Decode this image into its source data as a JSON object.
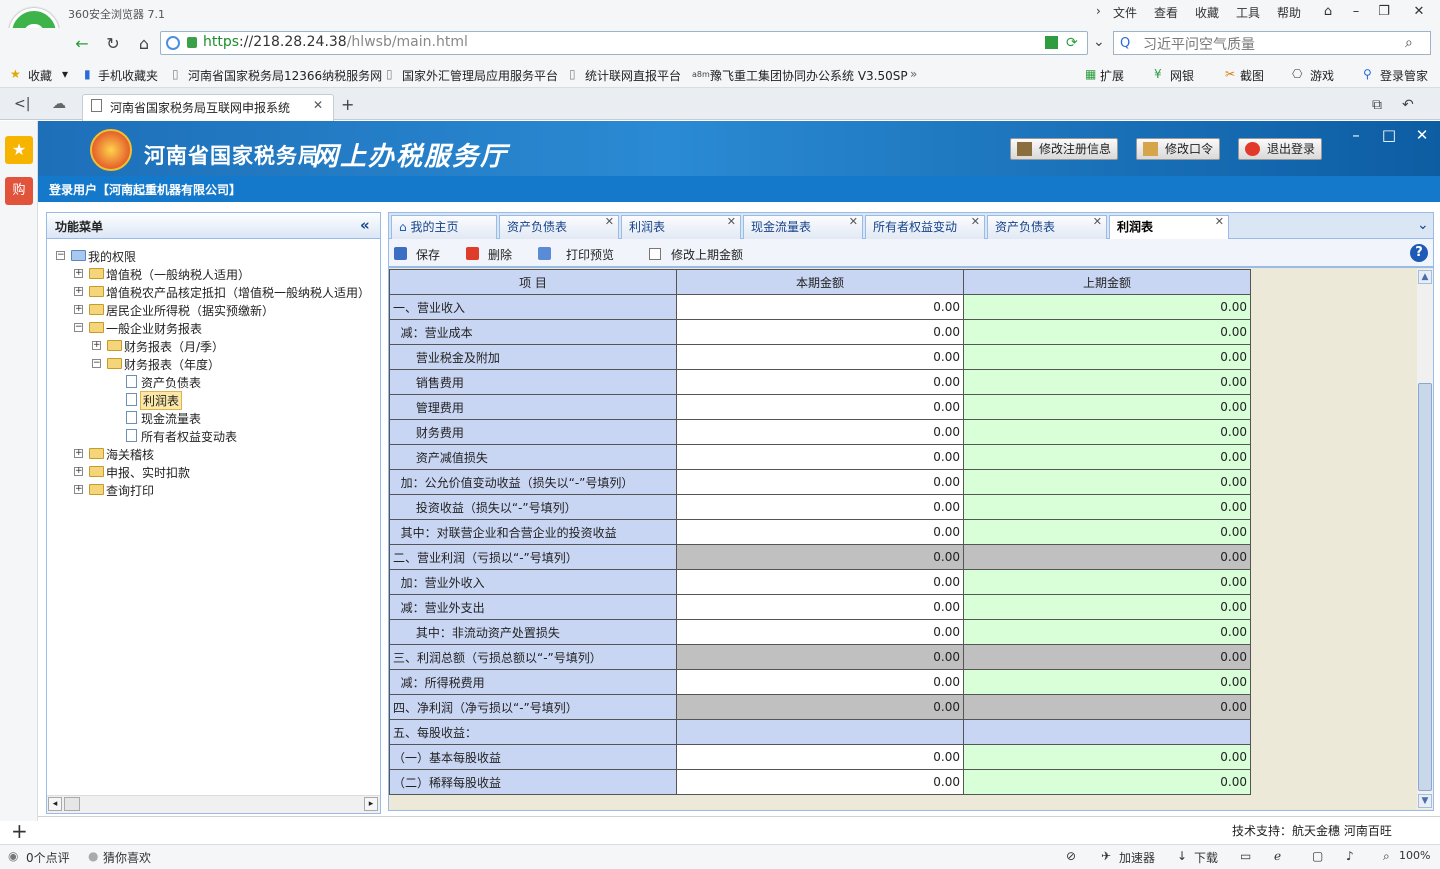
{
  "browser": {
    "name": "360安全浏览器 7.1",
    "menu": [
      "文件",
      "查看",
      "收藏",
      "工具",
      "帮助"
    ],
    "url_scheme": "https",
    "url_host": "://218.28.24.38",
    "url_path": "/hlwsb/main.html",
    "search_placeholder": "习近平问空气质量",
    "favorites": [
      "收藏",
      "手机收藏夹",
      "河南省国家税务局12366纳税服务网",
      "国家外汇管理局应用服务平台",
      "统计联网直报平台",
      "豫飞重工集团协同办公系统 V3.50SP"
    ],
    "tools": [
      "扩展",
      "网银",
      "截图",
      "游戏",
      "登录管家"
    ],
    "tab_title": "河南省国家税务局互联网申报系统",
    "status_left": [
      "0个点评",
      "猜你喜欢"
    ],
    "status_right": [
      "加速器",
      "下载",
      "100%"
    ]
  },
  "site": {
    "title1": "河南省国家税务局",
    "title2": "网上办税服务厅",
    "btn_reg": "修改注册信息",
    "btn_pwd": "修改口令",
    "btn_logout": "退出登录",
    "user": "登录用户【河南起重机器有限公司】",
    "footer": "技术支持：航天金穗 河南百旺"
  },
  "menu": {
    "title": "功能菜单",
    "root": "我的权限",
    "n1": "增值税（一般纳税人适用）",
    "n2": "增值税农产品核定抵扣（增值税一般纳税人适用）",
    "n3": "居民企业所得税（据实预缴新）",
    "n4": "一般企业财务报表",
    "n4a": "财务报表（月/季）",
    "n4b": "财务报表（年度）",
    "l1": "资产负债表",
    "l2": "利润表",
    "l3": "现金流量表",
    "l4": "所有者权益变动表",
    "n5": "海关稽核",
    "n6": "申报、实时扣款",
    "n7": "查询打印"
  },
  "tabs": [
    "我的主页",
    "资产负债表",
    "利润表",
    "现金流量表",
    "所有者权益变动",
    "资产负债表",
    "利润表"
  ],
  "toolbar": {
    "save": "保存",
    "delete": "删除",
    "print": "打印预览",
    "modify": "修改上期金额"
  },
  "table": {
    "headers": [
      "项    目",
      "本期金额",
      "上期金额"
    ],
    "rows": [
      {
        "label": "一、营业收入",
        "cur": "0.00",
        "prev": "0.00"
      },
      {
        "label": "  减：营业成本",
        "cur": "0.00",
        "prev": "0.00"
      },
      {
        "label": "      营业税金及附加",
        "cur": "0.00",
        "prev": "0.00"
      },
      {
        "label": "      销售费用",
        "cur": "0.00",
        "prev": "0.00"
      },
      {
        "label": "      管理费用",
        "cur": "0.00",
        "prev": "0.00"
      },
      {
        "label": "      财务费用",
        "cur": "0.00",
        "prev": "0.00"
      },
      {
        "label": "      资产减值损失",
        "cur": "0.00",
        "prev": "0.00"
      },
      {
        "label": "  加：公允价值变动收益（损失以“-”号填列）",
        "cur": "0.00",
        "prev": "0.00"
      },
      {
        "label": "      投资收益（损失以“-”号填列）",
        "cur": "0.00",
        "prev": "0.00"
      },
      {
        "label": "  其中：对联营企业和合营企业的投资收益",
        "cur": "0.00",
        "prev": "0.00"
      },
      {
        "label": "二、营业利润（亏损以“-”号填列）",
        "cur": "0.00",
        "prev": "0.00"
      },
      {
        "label": "  加：营业外收入",
        "cur": "0.00",
        "prev": "0.00"
      },
      {
        "label": "  减：营业外支出",
        "cur": "0.00",
        "prev": "0.00"
      },
      {
        "label": "      其中：非流动资产处置损失",
        "cur": "0.00",
        "prev": "0.00"
      },
      {
        "label": "三、利润总额（亏损总额以“-”号填列）",
        "cur": "0.00",
        "prev": "0.00"
      },
      {
        "label": "  减：所得税费用",
        "cur": "0.00",
        "prev": "0.00"
      },
      {
        "label": "四、净利润（净亏损以“-”号填列）",
        "cur": "0.00",
        "prev": "0.00"
      },
      {
        "label": "五、每股收益：",
        "cur": "",
        "prev": ""
      },
      {
        "label": "（一）基本每股收益",
        "cur": "0.00",
        "prev": "0.00"
      },
      {
        "label": "（二）稀释每股收益",
        "cur": "0.00",
        "prev": "0.00"
      }
    ]
  }
}
